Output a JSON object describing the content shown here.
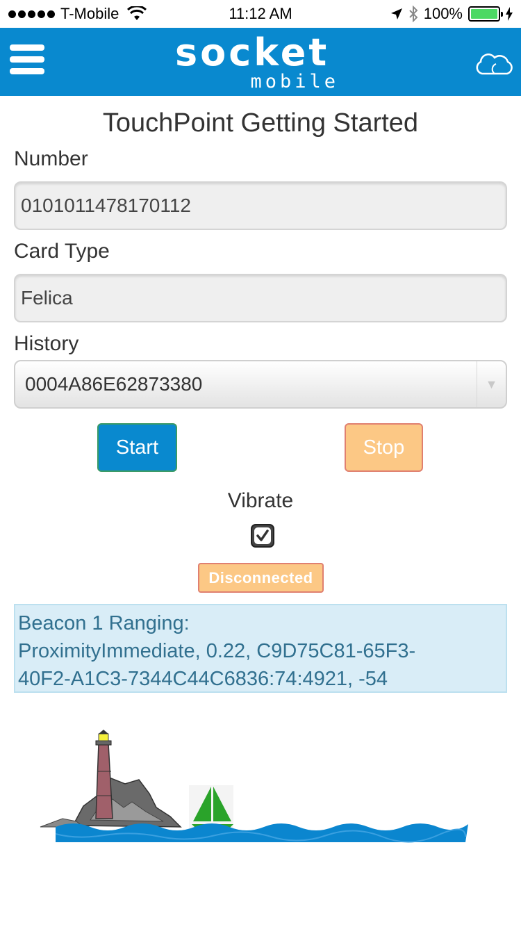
{
  "status_bar": {
    "carrier": "T-Mobile",
    "time": "11:12 AM",
    "battery": "100%",
    "battery_color": "#4cd964"
  },
  "header": {
    "logo_main": "socket",
    "logo_sub": "mobile",
    "background": "#0989cf",
    "menu_icon": "hamburger-icon",
    "cloud_icon": "cloud-icon"
  },
  "page": {
    "title": "TouchPoint Getting Started"
  },
  "form": {
    "number_label": "Number",
    "number_value": "0101011478170112",
    "card_type_label": "Card Type",
    "card_type_value": "Felica",
    "history_label": "History",
    "history_selected": "0004A86E62873380"
  },
  "buttons": {
    "start_label": "Start",
    "stop_label": "Stop"
  },
  "vibrate": {
    "label": "Vibrate",
    "checked": true
  },
  "connection": {
    "status": "Disconnected"
  },
  "beacon": {
    "line1": "Beacon 1 Ranging:",
    "line2": "ProximityImmediate, 0.22, C9D75C81-65F3-",
    "line3": "40F2-A1C3-7344C44C6836:74:4921, -54"
  }
}
